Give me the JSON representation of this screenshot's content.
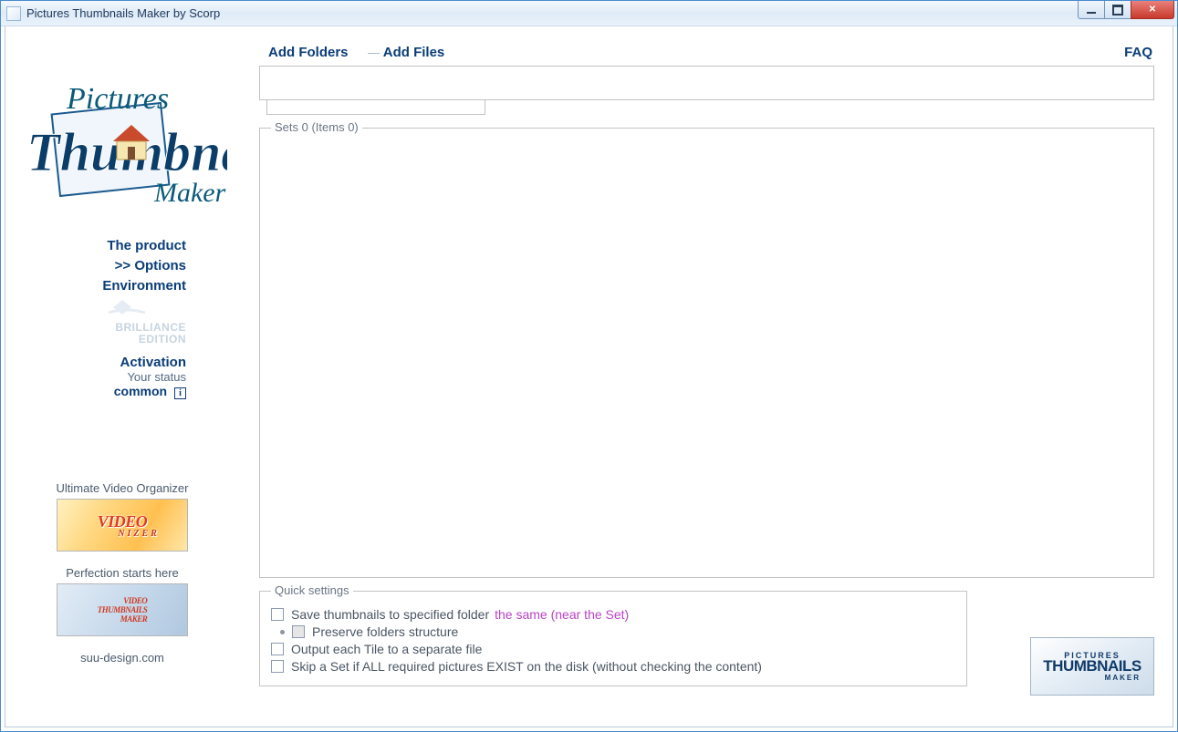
{
  "window": {
    "title": "Pictures Thumbnails Maker by Scorp"
  },
  "topbar": {
    "add_folders": "Add Folders",
    "add_files": "Add Files",
    "faq": "FAQ"
  },
  "sets": {
    "legend": "Sets 0 (Items 0)"
  },
  "quick": {
    "legend": "Quick settings",
    "save_to_folder": "Save thumbnails to specified folder",
    "save_to_folder_hint": "the same (near the Set)",
    "preserve": "Preserve folders structure",
    "output_each": "Output each Tile to a separate file",
    "skip_set": "Skip a Set if ALL required pictures EXIST on the disk (without checking the content)"
  },
  "nav": {
    "product": "The product",
    "options": ">> Options",
    "environment": "Environment",
    "brilliance1": "BRILLIANCE",
    "brilliance2": "EDITION",
    "activation": "Activation",
    "status_label": "Your status",
    "status_value": "common"
  },
  "promo": {
    "uvo_title": "Ultimate Video Organizer",
    "uvo_badge": "VIDEO",
    "uvo_badge2": "NIZER",
    "perf_title": "Perfection starts here",
    "vtm_l1": "VIDEO",
    "vtm_l2": "THUMBNAILS",
    "vtm_l3": "MAKER",
    "footer": "suu-design.com"
  },
  "corner": {
    "l1": "PICTURES",
    "l2": "THUMBNAILS",
    "l3": "MAKER"
  }
}
